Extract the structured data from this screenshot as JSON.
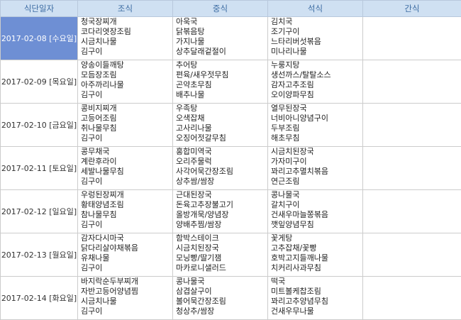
{
  "headers": [
    "식단일자",
    "조식",
    "중식",
    "석식",
    "간식"
  ],
  "selected_row": 0,
  "rows": [
    {
      "date": "2017-02-08 [수요일]",
      "breakfast": [
        "청국장찌개",
        "코다리엿장조림",
        "시금치나물",
        "김구이"
      ],
      "lunch": [
        "아욱국",
        "닭볶음탕",
        "가지나물",
        "상추달래겉절이"
      ],
      "dinner": [
        "김치국",
        "조기구이",
        "느타리버섯볶음",
        "미나리나물"
      ],
      "snack": []
    },
    {
      "date": "2017-02-09 [목요일]",
      "breakfast": [
        "양송이들깨탕",
        "모듬장조림",
        "아주까리나물",
        "김구이"
      ],
      "lunch": [
        "추어탕",
        "편육/새우젓무침",
        "곤약초무침",
        "배추나물"
      ],
      "dinner": [
        "누룽지탕",
        "생선까스/탈탈소스",
        "감자고추조림",
        "오이양파무침"
      ],
      "snack": []
    },
    {
      "date": "2017-02-10 [금요일]",
      "breakfast": [
        "콩비지찌개",
        "고등어조림",
        "취나물무침",
        "김구이"
      ],
      "lunch": [
        "우족탕",
        "오색잡채",
        "고사리나물",
        "오징어젓갈무침"
      ],
      "dinner": [
        "열무된장국",
        "너비아니양념구이",
        "두부조림",
        "해초무침"
      ],
      "snack": []
    },
    {
      "date": "2017-02-11 [토요일]",
      "breakfast": [
        "콩무채국",
        "계란후라이",
        "세발나물무침",
        "김구이"
      ],
      "lunch": [
        "홍합미역국",
        "오리주물럭",
        "사각어묵간장조림",
        "상추쌈/쌈장"
      ],
      "dinner": [
        "시금치된장국",
        "가자미구이",
        "꽈리고추멸치볶음",
        "연근조림"
      ],
      "snack": []
    },
    {
      "date": "2017-02-12 [일요일]",
      "breakfast": [
        "우렁된장찌개",
        "황태양념조림",
        "참나물무침",
        "김구이"
      ],
      "lunch": [
        "근대된장국",
        "돈육고추장불고기",
        "올방개묵/양념장",
        "양배추찜/쌈장"
      ],
      "dinner": [
        "콩나물국",
        "갈치구이",
        "건새우마늘쫑볶음",
        "깻잎양념무침"
      ],
      "snack": []
    },
    {
      "date": "2017-02-13 [월요일]",
      "breakfast": [
        "감자다시마국",
        "닭다리살야채볶음",
        "유채나물",
        "김구이"
      ],
      "lunch": [
        "함박스테이크",
        "시금치된장국",
        "모닝빵/딸기잼",
        "마카로니샐러드"
      ],
      "dinner": [
        "꽃게탕",
        "고추잡채/꽃빵",
        "호박고지들깨나물",
        "치커리사과무침"
      ],
      "snack": []
    },
    {
      "date": "2017-02-14 [화요일]",
      "breakfast": [
        "바지락순두부찌개",
        "자반고등어양념찜",
        "시금치나물",
        "김구이"
      ],
      "lunch": [
        "콩나물국",
        "삼겹살구이",
        "볼어묵간장조림",
        "청상추/쌈장"
      ],
      "dinner": [
        "떡국",
        "미트볼케찹조림",
        "꽈리고추양념무침",
        "건새우무나물"
      ],
      "snack": []
    }
  ]
}
